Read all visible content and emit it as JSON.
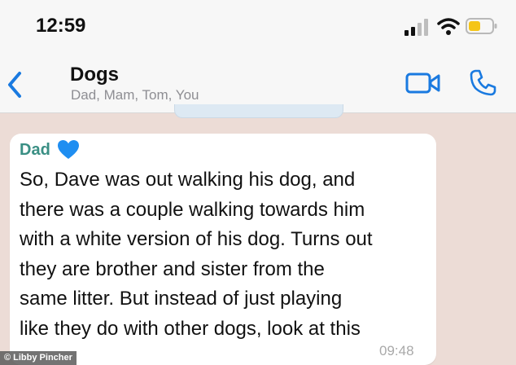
{
  "status_bar": {
    "time": "12:59",
    "icons": [
      "cellular-signal-icon",
      "wifi-icon",
      "battery-icon"
    ],
    "battery_color": "#f5c518"
  },
  "header": {
    "back_icon": "chevron-left-icon",
    "title": "Dogs",
    "participants": "Dad, Mam, Tom, You",
    "actions": [
      "video-call-icon",
      "phone-icon"
    ],
    "accent": "#1a7ae0"
  },
  "message": {
    "sender": "Dad",
    "sender_emoji": "blue-heart-icon",
    "sender_color": "#3a8f84",
    "lines": [
      "So, Dave was out walking his dog, and",
      "there was a couple walking towards him",
      "with a white version of his dog. Turns out",
      "they are brother and sister from the",
      "same litter. But instead of just playing",
      "like they do with other dogs, look at this"
    ],
    "time": "09:48"
  },
  "credit": "© Libby Pincher"
}
